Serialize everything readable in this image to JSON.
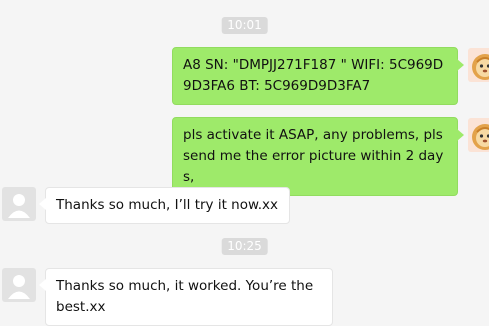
{
  "chat": {
    "timestamps": [
      "10:01",
      "10:25"
    ],
    "messages": [
      {
        "sender": "me",
        "text": "A8 SN: \"DMPJJ271F187 \" WIFI: 5C969D9D3FA6 BT: 5C969D9D3FA7"
      },
      {
        "sender": "me",
        "text": "pls activate it ASAP, any problems, pls send me the error picture within 2 days,"
      },
      {
        "sender": "contact",
        "text": "Thanks so much, I’ll try it now.xx"
      },
      {
        "sender": "contact",
        "text": "Thanks so much, it worked. You’re the best.xx"
      }
    ]
  },
  "icons": {
    "my_avatar": "lion-avatar-icon",
    "contact_avatar": "default-user-avatar-icon"
  },
  "colors": {
    "outgoing_bubble": "#9eea6a",
    "incoming_bubble": "#ffffff",
    "background": "#f5f5f5",
    "timestamp_pill": "#dadada"
  }
}
